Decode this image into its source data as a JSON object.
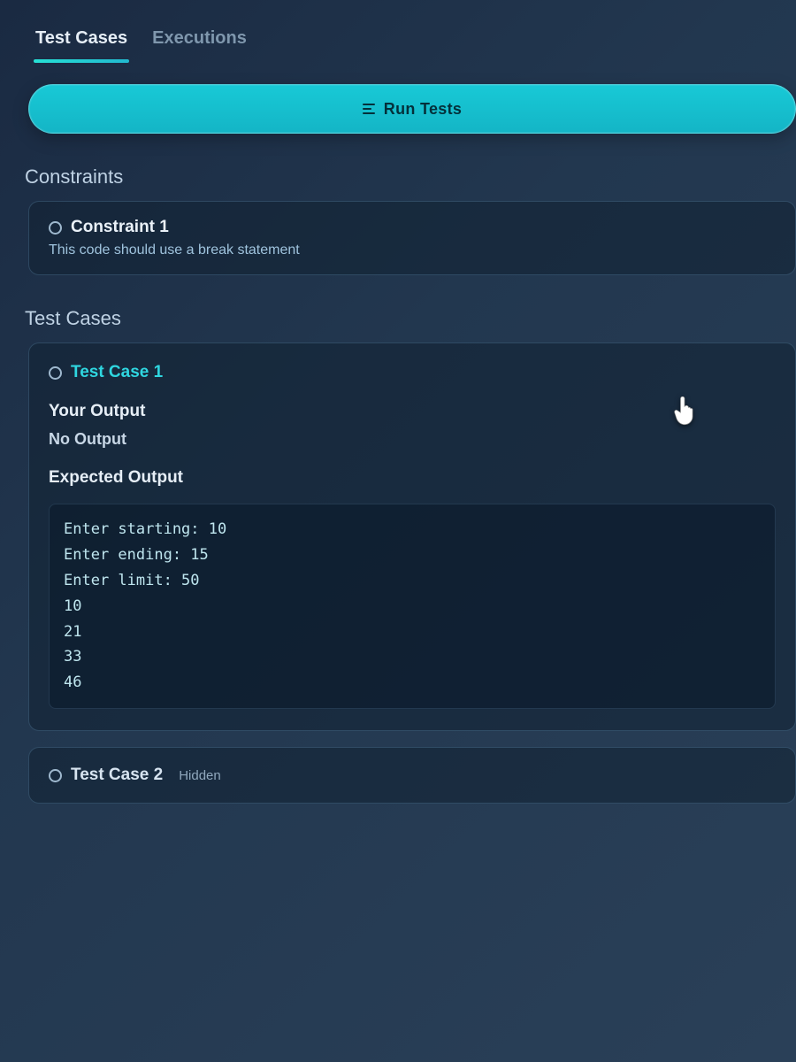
{
  "tabs": {
    "test_cases": "Test Cases",
    "executions": "Executions"
  },
  "run_button": {
    "label": "Run Tests"
  },
  "sections": {
    "constraints": "Constraints",
    "test_cases": "Test Cases"
  },
  "constraint1": {
    "title": "Constraint 1",
    "desc": "This code should use a break statement"
  },
  "testcase1": {
    "title": "Test Case 1",
    "your_output_label": "Your Output",
    "no_output": "No Output",
    "expected_label": "Expected Output",
    "expected_text": "Enter starting: 10\nEnter ending: 15\nEnter limit: 50\n10\n21\n33\n46"
  },
  "testcase2": {
    "title": "Test Case 2",
    "badge": "Hidden"
  }
}
